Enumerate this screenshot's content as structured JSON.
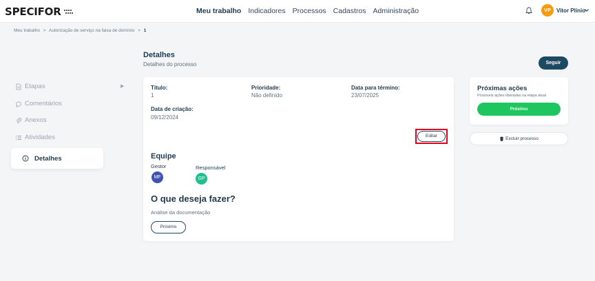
{
  "header": {
    "logo_text": "SPECIFOR",
    "nav": [
      "Meu trabalho",
      "Indicadores",
      "Processos",
      "Cadastros",
      "Administração"
    ],
    "nav_active_index": 0,
    "user": {
      "initials": "VP",
      "name": "Vitor Plínio"
    }
  },
  "breadcrumb": {
    "items": [
      "Meu trabalho",
      "Autorização de serviço na faixa de domínio",
      "1"
    ],
    "separator": ">"
  },
  "sidebar": {
    "items": [
      {
        "label": "Etapas",
        "icon": "document-icon"
      },
      {
        "label": "Comentários",
        "icon": "comment-icon"
      },
      {
        "label": "Anexos",
        "icon": "paperclip-icon"
      },
      {
        "label": "Atividades",
        "icon": "list-icon"
      }
    ],
    "active": {
      "label": "Detalhes",
      "icon": "info-icon"
    }
  },
  "main": {
    "title": "Detalhes",
    "subtitle": "Detalhes do processo",
    "follow_label": "Seguir",
    "fields": {
      "titulo": {
        "label": "Título:",
        "value": "1"
      },
      "prioridade": {
        "label": "Prioridade:",
        "value": "Não definido"
      },
      "termino": {
        "label": "Data para término:",
        "value": "23/07/2025"
      },
      "criacao": {
        "label": "Data de criação:",
        "value": "09/12/2024"
      }
    },
    "edit_label": "Editar",
    "team": {
      "title": "Equipe",
      "manager": {
        "role": "Gestor",
        "initials": "MF",
        "color": "#3f51b5"
      },
      "responsible": {
        "role": "Responsável",
        "initials": "GP",
        "color": "#1fbf8f"
      }
    },
    "action": {
      "title": "O que deseja fazer?",
      "current_step": "Análise da documentação",
      "next_label": "Próximo"
    }
  },
  "right": {
    "title": "Próximas ações",
    "subtitle": "Possíveis ações liberadas na etapa atual",
    "next_label": "Próximo",
    "delete_label": "Excluir processo",
    "accent": "#1fc55f"
  },
  "colors": {
    "primary": "#1d4a63",
    "highlight": "#e0001b",
    "avatar": "#f39c12"
  }
}
